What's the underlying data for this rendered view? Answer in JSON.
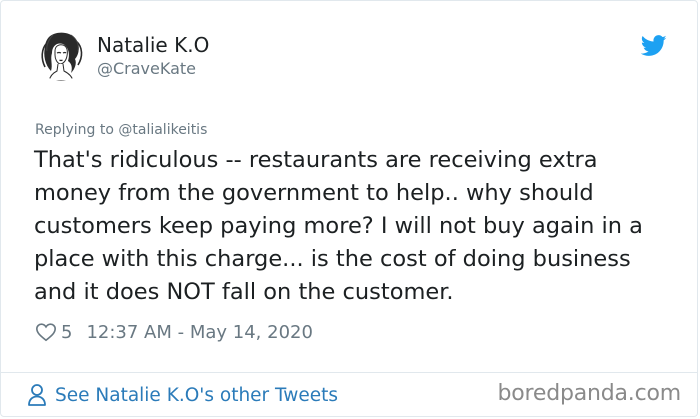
{
  "author": {
    "display_name": "Natalie K.O",
    "handle": "@CraveKate",
    "avatar_icon": "illustrated-woman-avatar"
  },
  "brand": {
    "icon": "twitter-bird-icon",
    "color": "#1da1f2"
  },
  "tweet": {
    "reply_text": "Replying to @talialikeitis",
    "text": "That's ridiculous -- restaurants are receiving extra money from the government to help.. why should customers keep paying more? I will not buy again in a place with this charge... is the cost of doing business and it does NOT fall on the customer.",
    "like_count": "5",
    "timestamp": "12:37 AM - May 14, 2020"
  },
  "footer": {
    "link_text": "See Natalie K.O's other Tweets",
    "link_color": "#2b7bb9",
    "watermark": "boredpanda.com"
  }
}
